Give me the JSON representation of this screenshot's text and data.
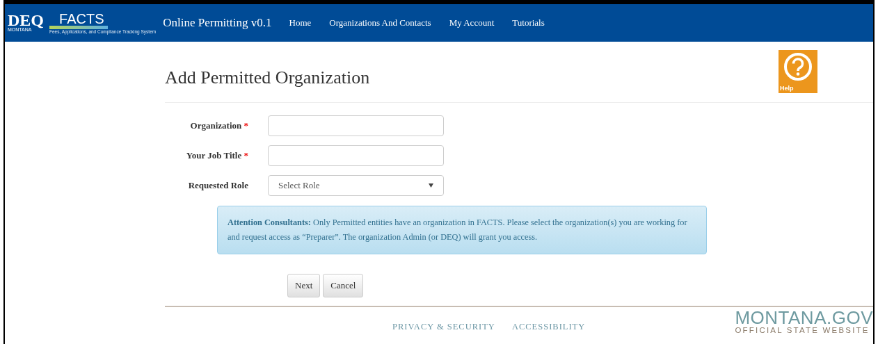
{
  "navbar": {
    "logo_main": "DEQ",
    "logo_sub": "MONTANA",
    "facts_logo": "FACTS",
    "facts_tagline": "Fees, Applications, and Compliance Tracking System",
    "app_title": "Online Permitting v0.1",
    "links": [
      {
        "label": "Home"
      },
      {
        "label": "Organizations And Contacts"
      },
      {
        "label": "My Account"
      },
      {
        "label": "Tutorials"
      }
    ]
  },
  "page_title": "Add Permitted Organization",
  "help_label": "Help",
  "form": {
    "required_mark": "*",
    "fields": [
      {
        "kind": "text",
        "label": "Organization",
        "required": true
      },
      {
        "kind": "text",
        "label": "Your Job Title",
        "required": true
      },
      {
        "kind": "select",
        "label": "Requested Role",
        "required": false,
        "value": "Select Role"
      }
    ]
  },
  "alert": {
    "text": "**Attention Consultants:** Only Permitted entities have an organization in FACTS. Please select the organization(s) you are working for and request access as “Preparer”. The organization Admin (or DEQ) will grant you access."
  },
  "buttons": [
    "Next",
    "Cancel"
  ],
  "footer": {
    "links": [
      "PRIVACY & SECURITY",
      "ACCESSIBILITY"
    ],
    "logo_main": "MONTANA.GOV",
    "logo_sub": "OFFICIAL STATE WEBSITE"
  }
}
